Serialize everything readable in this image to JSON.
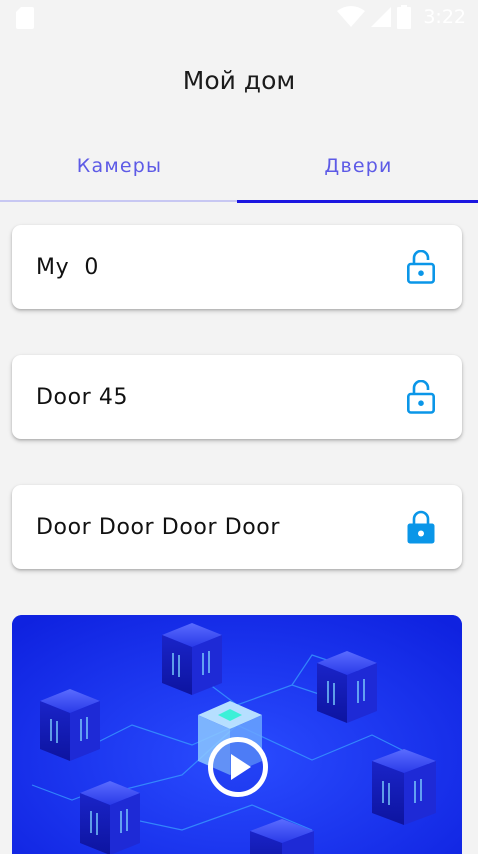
{
  "status_bar": {
    "time": "3:22",
    "icons": [
      "sd-card-icon",
      "wifi-icon",
      "signal-icon",
      "battery-icon"
    ]
  },
  "header": {
    "title": "Мой дом"
  },
  "tabs": [
    {
      "label": "Камеры",
      "selected": false
    },
    {
      "label": "Двери",
      "selected": true
    }
  ],
  "doors": [
    {
      "name": "My  0",
      "lock_state": "unlocked"
    },
    {
      "name": "Door 45",
      "lock_state": "unlocked"
    },
    {
      "name": "Door Door Door Door",
      "lock_state": "locked"
    }
  ],
  "banner": {
    "icon": "play-icon"
  },
  "colors": {
    "accent": "#5d5ae6",
    "tab_indicator": "#1b16e0",
    "lock_icon": "#0a96e8",
    "banner_bg": "#1430f0"
  }
}
